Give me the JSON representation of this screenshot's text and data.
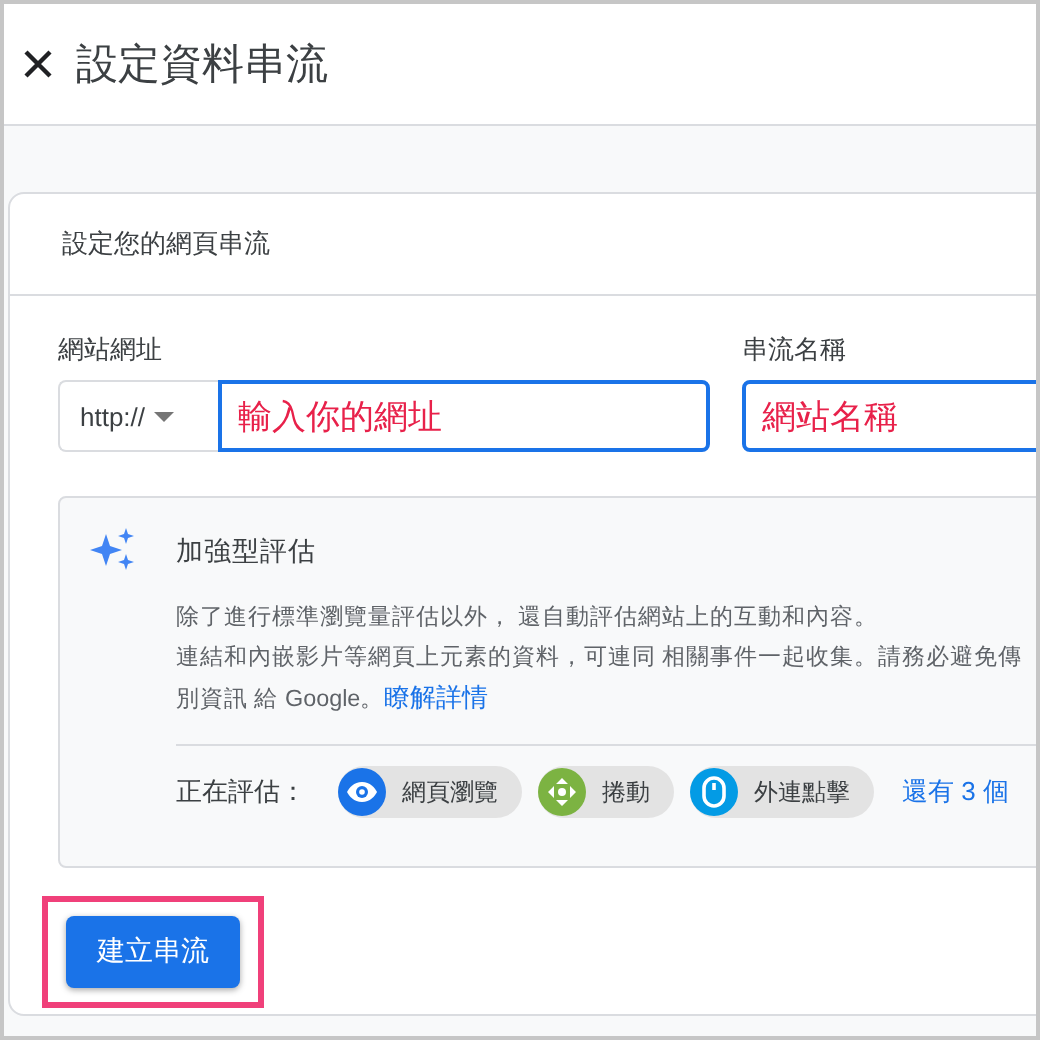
{
  "header": {
    "title": "設定資料串流"
  },
  "card": {
    "title": "設定您的網頁串流",
    "url_field": {
      "label": "網站網址",
      "protocol": "http://",
      "value": "輸入你的網址"
    },
    "name_field": {
      "label": "串流名稱",
      "value": "網站名稱"
    },
    "enhanced": {
      "title": "加強型評估",
      "lines": [
        "除了進行標準瀏覽量評估以外， 還自動評估網站上的互動和內容。",
        "連結和內嵌影片等網頁上元素的資料，可連同 相關事件一起收集。請務必避免傳",
        "別資訊 給 Google。"
      ],
      "link": "瞭解詳情",
      "measuring_label": "正在評估：",
      "chips": [
        {
          "kind": "eye",
          "label": "網頁瀏覽",
          "color": "#1a73e8"
        },
        {
          "kind": "move",
          "label": "捲動",
          "color": "#7cb342"
        },
        {
          "kind": "mouse",
          "label": "外連點擊",
          "color": "#039be5"
        }
      ],
      "more": "還有 3 個"
    },
    "button": {
      "label": "建立串流",
      "highlighted": true
    }
  }
}
